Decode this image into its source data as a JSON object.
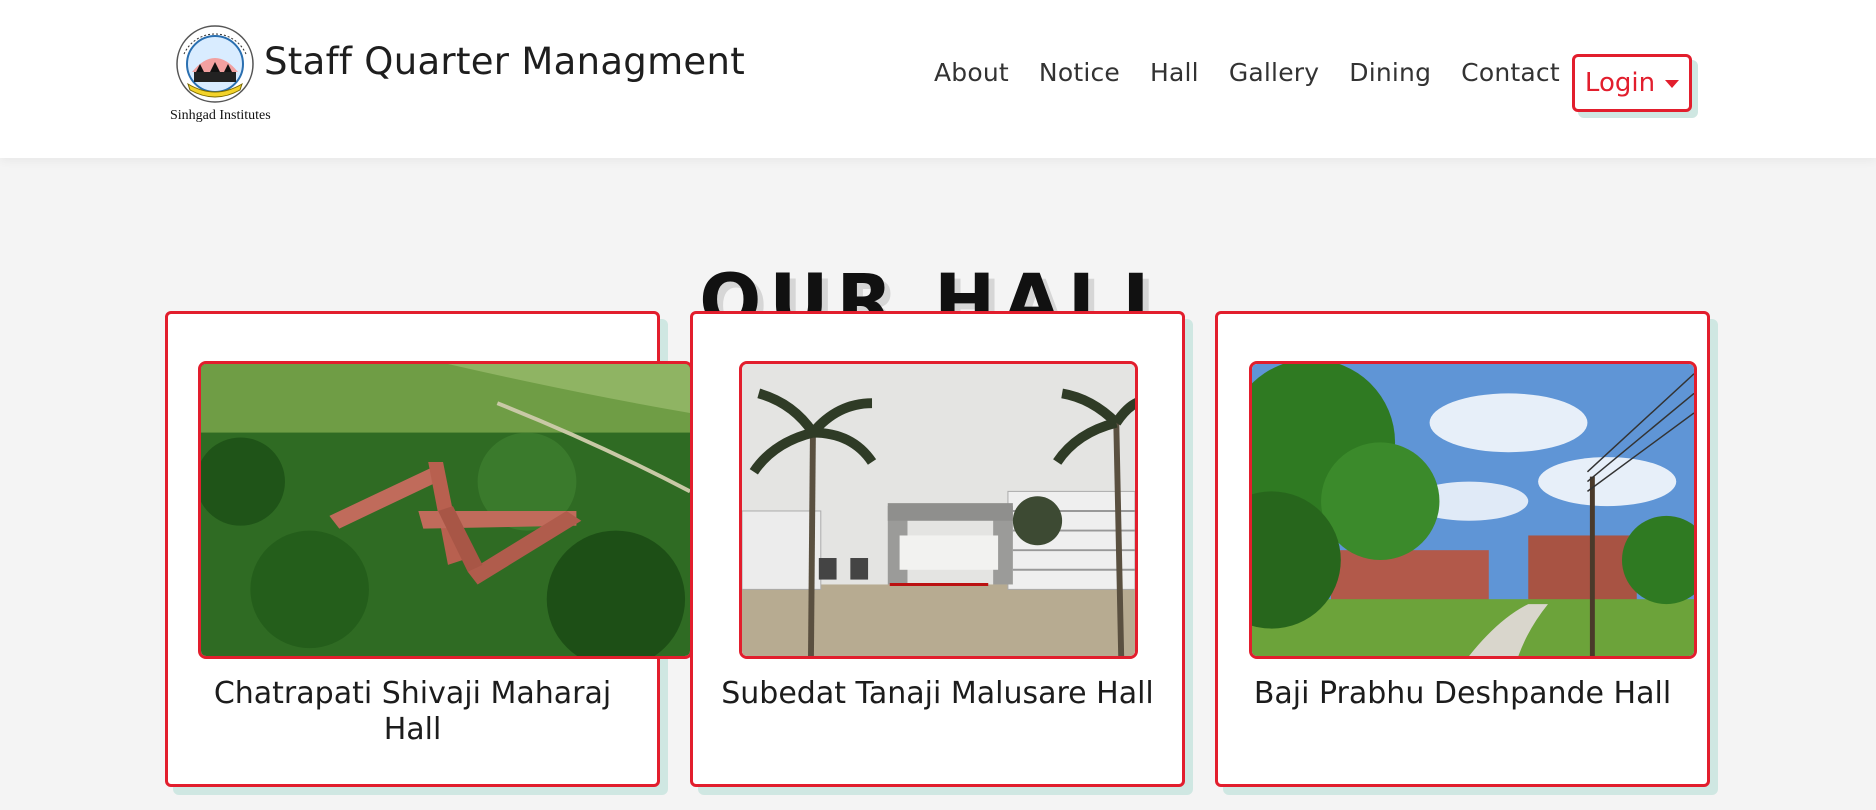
{
  "brand": {
    "logo_caption": "Sinhgad Institutes",
    "name": "Staff Quarter Managment"
  },
  "nav": {
    "links": [
      "About",
      "Notice",
      "Hall",
      "Gallery",
      "Dining",
      "Contact"
    ],
    "login_label": "Login"
  },
  "page": {
    "heading": "OUR HALL"
  },
  "halls": [
    {
      "name": "Chatrapati Shivaji Maharaj Hall"
    },
    {
      "name": "Subedat Tanaji Malusare Hall"
    },
    {
      "name": "Baji Prabhu Deshpande Hall"
    }
  ],
  "colors": {
    "accent": "#e21e2d",
    "shadow": "#cfe7e2",
    "background": "#f4f4f4"
  }
}
